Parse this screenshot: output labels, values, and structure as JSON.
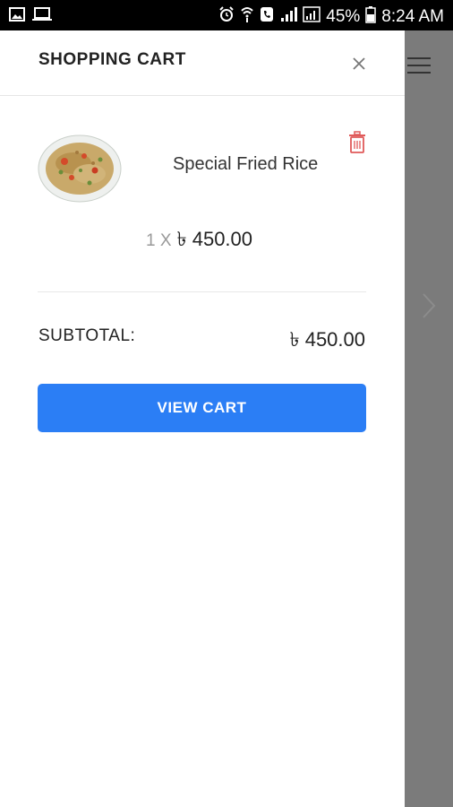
{
  "status_bar": {
    "battery": "45%",
    "time": "8:24 AM"
  },
  "drawer": {
    "title": "SHOPPING CART",
    "close_icon": "close-icon"
  },
  "cart": {
    "items": [
      {
        "name": "Special Fried Rice",
        "quantity": "1 X",
        "price": "৳ 450.00",
        "image_icon": "fried-rice-image",
        "delete_icon": "trash-icon"
      }
    ],
    "subtotal_label": "SUBTOTAL:",
    "subtotal_value": "৳ 450.00",
    "view_cart_label": "VIEW CART"
  },
  "colors": {
    "accent": "#2b7ef5",
    "delete": "#e05a5a",
    "overlay": "#7a7a7a"
  }
}
